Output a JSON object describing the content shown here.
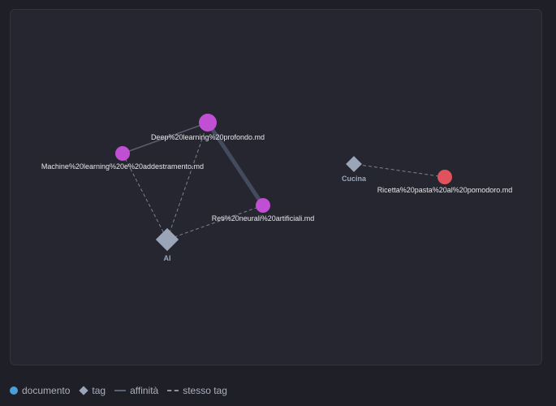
{
  "graph": {
    "nodes": {
      "deep_learning": {
        "label": "Deep%20learning%20profondo.md",
        "color": "#c04fd4",
        "type": "documento"
      },
      "machine_learning": {
        "label": "Machine%20learning%20e%20addestramento.md",
        "color": "#c04fd4",
        "type": "documento"
      },
      "reti_neurali": {
        "label": "Reti%20neurali%20artificiali.md",
        "color": "#c04fd4",
        "type": "documento"
      },
      "ricetta": {
        "label": "Ricetta%20pasta%20al%20pomodoro.md",
        "color": "#e0525c",
        "type": "documento"
      },
      "tag_ai": {
        "label": "AI",
        "color": "#9aa6b8",
        "type": "tag"
      },
      "tag_cucina": {
        "label": "Cucina",
        "color": "#9aa6b8",
        "type": "tag"
      }
    },
    "edges": [
      {
        "from": "deep_learning",
        "to": "reti_neurali",
        "kind": "affinità"
      },
      {
        "from": "deep_learning",
        "to": "machine_learning",
        "kind": "affinità"
      },
      {
        "from": "machine_learning",
        "to": "tag_ai",
        "kind": "stesso tag"
      },
      {
        "from": "deep_learning",
        "to": "tag_ai",
        "kind": "stesso tag"
      },
      {
        "from": "reti_neurali",
        "to": "tag_ai",
        "kind": "stesso tag"
      },
      {
        "from": "ricetta",
        "to": "tag_cucina",
        "kind": "stesso tag"
      }
    ]
  },
  "legend": {
    "documento": "documento",
    "tag": "tag",
    "affinita": "affinità",
    "stesso_tag": "stesso tag"
  },
  "colors": {
    "background": "#1f1f27",
    "panel": "#262630",
    "document_purple": "#c04fd4",
    "document_red": "#e0525c",
    "tag": "#9aa6b8",
    "legend_document": "#4a9fd8",
    "affinity_edge": "#434b5c",
    "tag_edge": "#7b8394"
  }
}
